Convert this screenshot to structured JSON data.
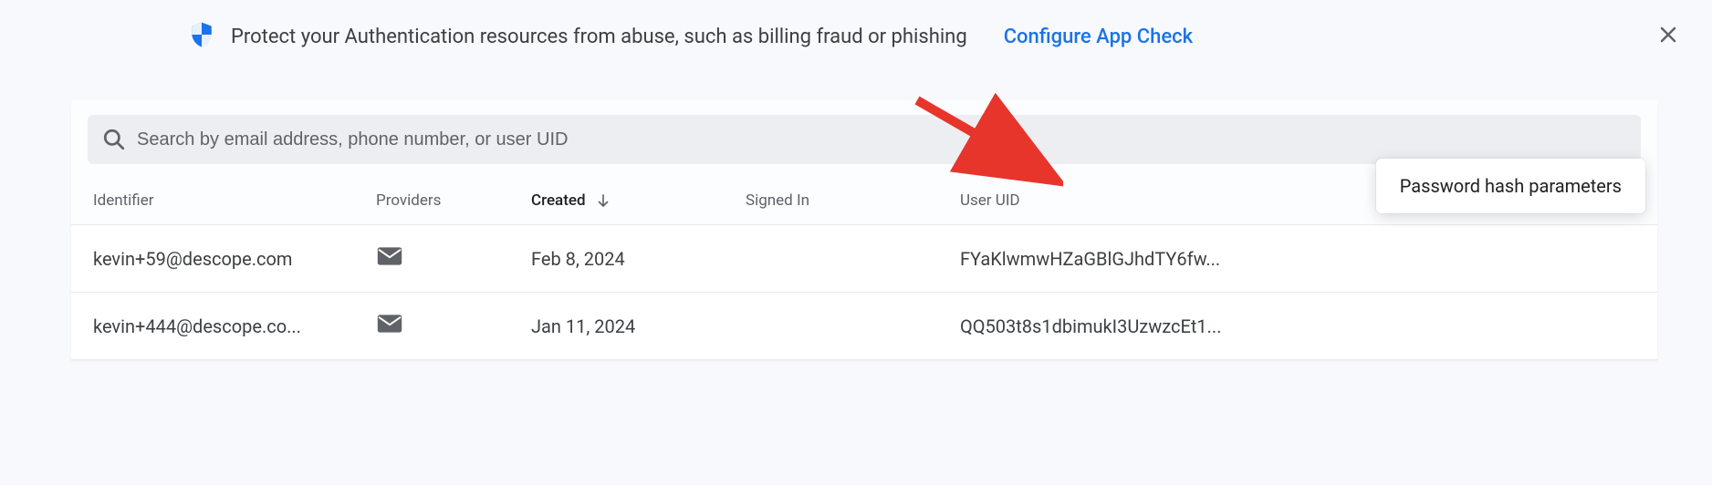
{
  "banner": {
    "text": "Protect your Authentication resources from abuse, such as billing fraud or phishing",
    "link": "Configure App Check"
  },
  "search": {
    "placeholder": "Search by email address, phone number, or user UID"
  },
  "columns": {
    "identifier": "Identifier",
    "providers": "Providers",
    "created": "Created",
    "signedin": "Signed In",
    "uid": "User UID"
  },
  "rows": [
    {
      "identifier": "kevin+59@descope.com",
      "created": "Feb 8, 2024",
      "signedin": "",
      "uid": "FYaKlwmwHZaGBlGJhdTY6fw..."
    },
    {
      "identifier": "kevin+444@descope.co...",
      "created": "Jan 11, 2024",
      "signedin": "",
      "uid": "QQ503t8s1dbimukI3UzwzcEt1..."
    }
  ],
  "popup": {
    "label": "Password hash parameters"
  }
}
